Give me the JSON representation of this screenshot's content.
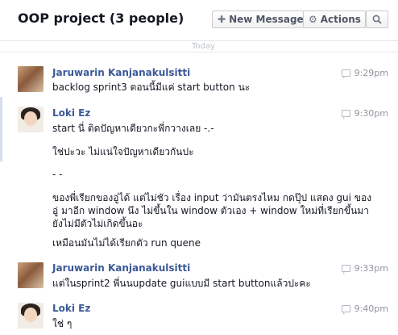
{
  "header": {
    "title": "OOP project (3 people)",
    "new_message_label": "New Message",
    "actions_label": "Actions",
    "new_message_icon": "plus-icon",
    "actions_icon": "gear-icon",
    "search_icon": "search-icon"
  },
  "separator": {
    "label": "Today"
  },
  "messages": [
    {
      "author": "Jaruwarin Kanjanakulsitti",
      "time": "9:29pm",
      "lines": [
        "backlog sprint3 ตอนนี้มีแค่ start button นะ"
      ]
    },
    {
      "author": "Loki Ez",
      "time": "9:30pm",
      "lines": [
        "start นี่ ติดปัญหาเดียวกะพี่กวางเลย -.-",
        "ใช่ปะวะ  ไม่แน่ใจปัญหาเดียวกันปะ",
        "- -",
        "ของพี่เรียกของอู่ได้ แต่ไม่ชัว เรื่อง input ว่ามันตรงไหม  กดปุ๊ป แสดง gui ของอู่ มาอีก window นึง ไม่ขึ้นใน window ตัวเอง + window ใหม่ที่เรียกขึ้นมา ยังไม่มีตัวไม่เกิดขึ้นอะ",
        "เหมือนมันไม่ได้เรียกตัว run quene"
      ]
    },
    {
      "author": "Jaruwarin Kanjanakulsitti",
      "time": "9:33pm",
      "lines": [
        "แต่ในsprint2 พี่นนupdate guiแบบมี start buttonแล้วปะคะ"
      ]
    },
    {
      "author": "Loki Ez",
      "time": "9:40pm",
      "lines": [
        "ใช่ ๆ"
      ]
    }
  ]
}
